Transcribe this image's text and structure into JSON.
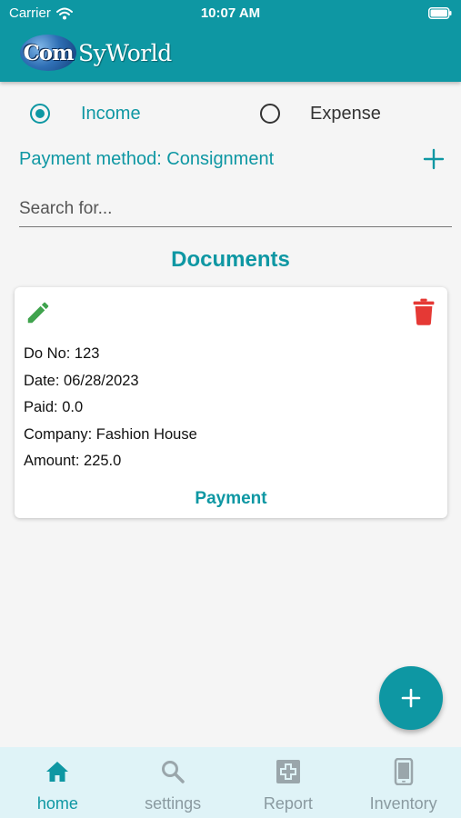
{
  "status_bar": {
    "carrier": "Carrier",
    "time": "10:07 AM"
  },
  "header": {
    "logo_globe_text": "Com",
    "logo_rest_text": "SyWorld"
  },
  "type_selector": {
    "options": [
      {
        "label": "Income",
        "selected": true
      },
      {
        "label": "Expense",
        "selected": false
      }
    ]
  },
  "payment_method": {
    "label": "Payment method: Consignment"
  },
  "search": {
    "placeholder": "Search for..."
  },
  "documents": {
    "title": "Documents",
    "cards": [
      {
        "lines": [
          "Do No: 123",
          "Date: 06/28/2023",
          "Paid: 0.0",
          "Company: Fashion House",
          "Amount: 225.0"
        ],
        "action_label": "Payment"
      }
    ]
  },
  "bottom_nav": {
    "items": [
      {
        "label": "home",
        "icon": "home-icon",
        "active": true
      },
      {
        "label": "settings",
        "icon": "search-icon",
        "active": false
      },
      {
        "label": "Report",
        "icon": "report-icon",
        "active": false
      },
      {
        "label": "Inventory",
        "icon": "phone-icon",
        "active": false
      }
    ]
  },
  "colors": {
    "primary": "#0e97a3",
    "edit": "#3fa34d",
    "delete": "#e53935",
    "nav_background": "#dff3f7",
    "nav_inactive": "#8a9aa0"
  }
}
